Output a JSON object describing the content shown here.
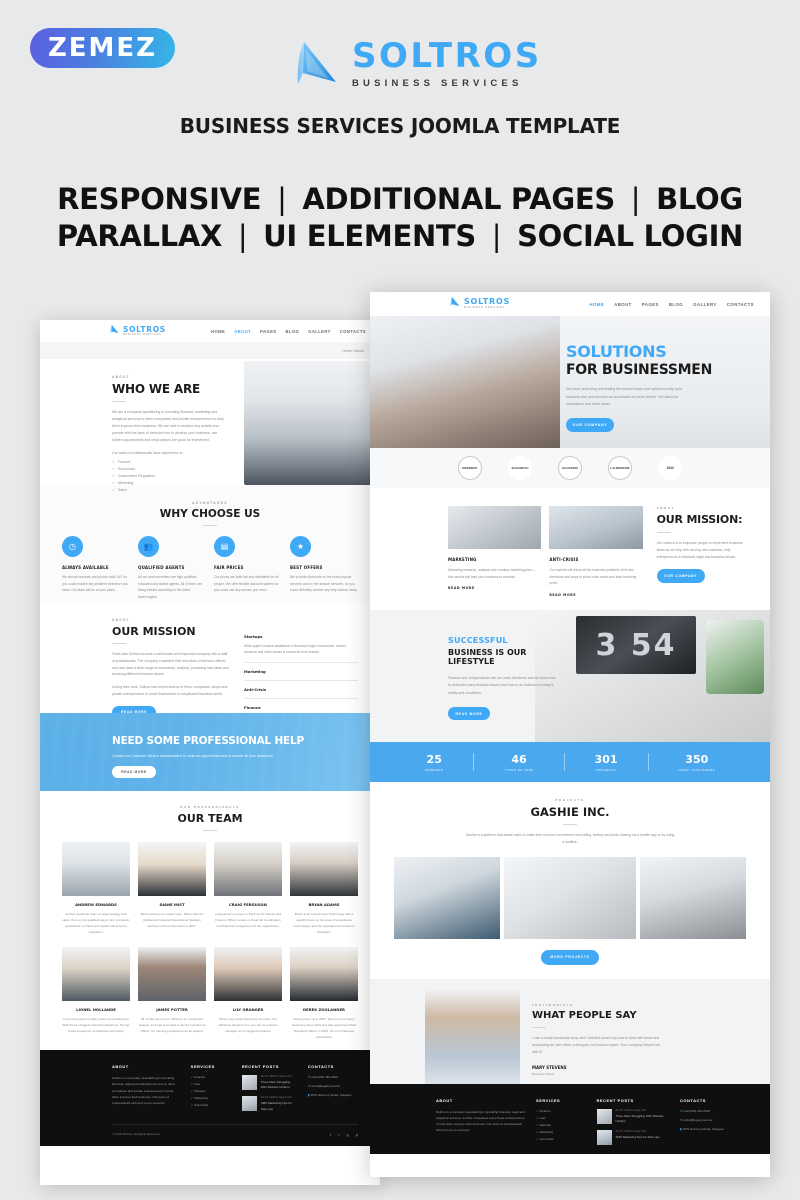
{
  "promo": {
    "vendor_badge": "ZEMEZ",
    "brand_name": "SOLTROS",
    "brand_tagline": "BUSINESS SERVICES",
    "title": "BUSINESS SERVICES JOOMLA TEMPLATE",
    "features_line1": [
      "RESPONSIVE",
      "ADDITIONAL PAGES",
      "BLOG"
    ],
    "features_line2": [
      "PARALLAX",
      "UI ELEMENTS",
      "SOCIAL LOGIN"
    ],
    "separator": "|",
    "colors": {
      "accent": "#3fa9f5",
      "background": "#e8e9ea",
      "badge_start": "#5b5ee0",
      "badge_end": "#35b7e8"
    }
  },
  "nav": {
    "logo": "SOLTROS",
    "logo_sub": "BUSINESS SERVICES",
    "items": [
      "HOME",
      "ABOUT",
      "PAGES",
      "BLOG",
      "GALLERY",
      "CONTACTS"
    ],
    "active_home": "HOME",
    "active_about": "ABOUT"
  },
  "home_page": {
    "hero": {
      "title_line1": "SOLUTIONS",
      "title_line2": "FOR BUSINESSMEN",
      "text": "We prize searching and finding the newest ways and options to help your business rise and become as successful as never before. We stand for innovations and fresh ideas.",
      "cta": "OUR COMPANY"
    },
    "badges": [
      "BREWERY",
      "ELIZABETH",
      "BLOSSOM",
      "LAURENTINE",
      "1942"
    ],
    "mission": {
      "eyebrow": "ABOUT",
      "title": "OUR MISSION:",
      "text": "Our mission is to empower people to implement business ideas as we help with serving new business, help entrepreneurs in financial, legal and business issues.",
      "cta": "OUR COMPANY",
      "cards": [
        {
          "title": "MARKETING",
          "text": "Marketing research, analysis and creating marketing plan — this service will lead your business to success.",
          "link": "READ MORE"
        },
        {
          "title": "ANTI-CRISIS",
          "text": "Our experts will check all the business problems, find new directions and ways to solve crisis cases and start receiving profit.",
          "link": "READ MORE"
        }
      ]
    },
    "lifestyle": {
      "title_accent": "SUCCESSFUL",
      "title_line2": "BUSINESS IS OUR",
      "title_line3": "LIFESTYLE",
      "text": "Finance and Jurisprudence are our main directions and we know how to deal with many financial issues and how to do business in today's reality and conditions.",
      "cta": "READ MORE"
    },
    "stats": [
      {
        "number": "25",
        "label": "WORKERS"
      },
      {
        "number": "46",
        "label": "TYPES OF JOBS"
      },
      {
        "number": "301",
        "label": "PROJECTS"
      },
      {
        "number": "350",
        "label": "HAPPY CUSTOMERS"
      }
    ],
    "projects": {
      "eyebrow": "PROJECTS",
      "title": "GASHIE INC.",
      "text": "Gashie is a platform that allows users to make free and low cost internet and calling, texting and photo sharing via a mobile app or by using a landline.",
      "cta": "MORE PROJECTS"
    },
    "testimonials": {
      "eyebrow": "TESTIMONIALS",
      "title": "WHAT PEOPLE SAY",
      "quote": "I own a small handmade shop and I needed some help how to deal with taxes and accounting as I am rather a designer, not finance expert. Your company helped me with it!",
      "author": "MARY STEVENS",
      "role": "Business Owner"
    }
  },
  "about_page": {
    "breadcrumb": "Home / About",
    "who": {
      "eyebrow": "ABOUT",
      "title": "WHO WE ARE",
      "paragraph": "We are a company specializing in providing financial, marketing and analytical services to other companies and private entrepreneurs to help them improve their business. We are able to analyze any activity and provide with the facts of decision how to develop your business, use hidden opportunities and what options are good for investment.",
      "list_intro": "Our team of professionals have experience in:",
      "list": [
        "Finance",
        "Economics",
        "Government Regulation",
        "Marketing",
        "Sales"
      ]
    },
    "advantages": {
      "eyebrow": "ADVANTAGES",
      "title": "WHY CHOOSE US",
      "items": [
        {
          "icon": "clock-icon",
          "title": "ALWAYS AVAILABLE",
          "text": "We accept requests and phone calls 24/7 so you could resolve any problem whenever you need. Our team will be at your place."
        },
        {
          "icon": "users-icon",
          "title": "QUALIFIED AGENTS",
          "text": "All our team members are high-qualified, educated and skilled agents. All of them are being trained according to the latest technologies."
        },
        {
          "icon": "card-icon",
          "title": "FAIR PRICES",
          "text": "Our prices are both fair and affordable for all people. We offer flexible discount system so you could use any service you need."
        },
        {
          "icon": "star-icon",
          "title": "BEST OFFERS",
          "text": "We provide discounts on the most popular services and on the season services, so you could definitely receive any help without delay."
        }
      ]
    },
    "mission": {
      "eyebrow": "ABOUT",
      "title": "OUR MISSION",
      "paragraph1": "Years later Soltros became a well-known and respected company with a staff of professionals. The company expanded their directions of services offered and now have a wide range of researches, analysis, producing new ideas and resolving different business issues.",
      "paragraph2": "During their work, Soltros has helped dozens of firms, companies, shops and private entrepreneurs to unveil themselves in complicated business world.",
      "cta": "READ MORE",
      "accordion": [
        {
          "title": "Startups",
          "text": "Start-uppers receive assistance in financial, legal, economical, human resource and other issues is crucial for their brands.",
          "open": true
        },
        {
          "title": "Marketing",
          "text": "",
          "open": false
        },
        {
          "title": "Anti-Crisis",
          "text": "",
          "open": false
        },
        {
          "title": "Finance",
          "text": "",
          "open": false
        }
      ]
    },
    "cta_banner": {
      "title": "NEED SOME PROFESSIONAL HELP",
      "text": "Contact our Customer Service representative to make an appointment and to answer all your questions!",
      "button": "READ MORE"
    },
    "team": {
      "eyebrow": "OUR PROFESSIONALS",
      "title": "OUR TEAM",
      "members": [
        {
          "name": "ANDREW EDWARDS",
          "bio": "Andrew leads the team on legal strategy and sales. He is a CU-qualified lawyer who previously specialized in a New and Intellectual property legislation."
        },
        {
          "name": "DIANE MIST",
          "bio": "Before joining our expert team, Diane was the Deliberate Financial Specialist at Startups Ventures and London team in 2007."
        },
        {
          "name": "CRAIG FERGUSON",
          "bio": "Craig joined our team in 2015 as the Clients and Finance Officer to take on financial coordination and financial management of the organization."
        },
        {
          "name": "BRYAN ADAMS",
          "bio": "Bryan is an Investments Technology with a specific focus on the area of surveillance technologies and the transparent investment strategies."
        },
        {
          "name": "LIONEL HOLLANDE",
          "bio": "Lionel has joined us after years of consulting for Wall Street's biggest financial institutions. He has broad experience at financial community."
        },
        {
          "name": "JAMES POTTER",
          "bio": "Mr. Potter joined us in 2010 as an Investment Analyst, and was promoted to Senior Investment Officer. He has long experience as an analyst."
        },
        {
          "name": "LILY GRANGER",
          "bio": "Where Lily works hard since 12 years, her efficiency allowed us to see her as a Senior manager of our biggest problems."
        },
        {
          "name": "DEREK ZOOLANDER",
          "bio": "Derek joined us in 2007, has been Company Secretary since 2010 and was appointed Chief Operating Officer in 2015. He is a Chartered Accountant."
        }
      ]
    }
  },
  "footer": {
    "about_title": "ABOUT",
    "about_text": "Soltros is a company specializing in providing financial, legal and analytical services to other companies and private entrepreneurs to help them improve their business. Our team of professionals with and you to success!",
    "services_title": "SERVICES",
    "services": [
      "Finance",
      "Law",
      "Startups",
      "Marketing",
      "Anti-Crisis"
    ],
    "posts_title": "RECENT POSTS",
    "posts": [
      {
        "meta": "Apr 07, 2018 by Super User",
        "title": "Three Main Struggling With Website Uniform"
      },
      {
        "meta": "Apr 07, 2018 by Super User",
        "title": "SMS Marketing Tips for Start-ups"
      }
    ],
    "contacts_title": "CONTACTS",
    "contacts": [
      {
        "icon": "phone-icon",
        "text": "Call (046) 454-2636"
      },
      {
        "icon": "mail-icon",
        "text": "us1st@legacy.service"
      },
      {
        "icon": "pin-icon",
        "text": "4576 Harmony Road, Glasgow"
      }
    ],
    "copyright": "© 2018 Soltros. All Rights Reserved",
    "social": [
      "facebook-icon",
      "twitter-icon",
      "google-icon",
      "pinterest-icon"
    ]
  }
}
